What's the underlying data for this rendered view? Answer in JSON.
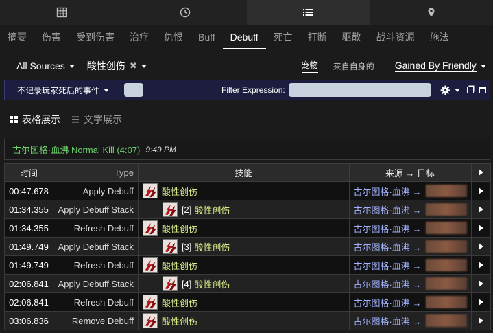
{
  "icon_bar": {
    "tabs": [
      {
        "icon": "grid-icon",
        "active": false
      },
      {
        "icon": "clock-icon",
        "active": false
      },
      {
        "icon": "list-icon",
        "active": true
      },
      {
        "icon": "map-pin-icon",
        "active": false
      }
    ]
  },
  "tabs": [
    "摘要",
    "伤害",
    "受到伤害",
    "治疗",
    "仇恨",
    "Buff",
    "Debuff",
    "死亡",
    "打断",
    "驱散",
    "战斗资源",
    "施法"
  ],
  "active_tab": "Debuff",
  "filters": {
    "source": "All Sources",
    "ability": "酸性创伤",
    "clear_mark": "✖",
    "toggle_pet": "宠物",
    "toggle_self": "来自自身的",
    "friendly": "Gained By Friendly"
  },
  "expression_bar": {
    "ignore_deaths": "不记录玩家死后的事件",
    "filter_label": "Filter Expression:",
    "filter_value": ""
  },
  "view": {
    "table_label": "表格展示",
    "text_label": "文字展示"
  },
  "fight": {
    "name": "古尔图格·血沸 Normal Kill (4:07)",
    "time": "9:49 PM"
  },
  "table": {
    "headers": {
      "time": "时间",
      "type": "Type",
      "skill": "技能",
      "source": "来源 → 目标"
    },
    "rows": [
      {
        "time": "00:47.678",
        "type": "Apply Debuff",
        "stack": "",
        "skill": "酸性创伤",
        "source": "古尔图格·血沸 →"
      },
      {
        "time": "01:34.355",
        "type": "Apply Debuff Stack",
        "stack": "[2]",
        "skill": "酸性创伤",
        "source": "古尔图格·血沸 →"
      },
      {
        "time": "01:34.355",
        "type": "Refresh Debuff",
        "stack": "",
        "skill": "酸性创伤",
        "source": "古尔图格·血沸 →"
      },
      {
        "time": "01:49.749",
        "type": "Apply Debuff Stack",
        "stack": "[3]",
        "skill": "酸性创伤",
        "source": "古尔图格·血沸 →"
      },
      {
        "time": "01:49.749",
        "type": "Refresh Debuff",
        "stack": "",
        "skill": "酸性创伤",
        "source": "古尔图格·血沸 →"
      },
      {
        "time": "02:06.841",
        "type": "Apply Debuff Stack",
        "stack": "[4]",
        "skill": "酸性创伤",
        "source": "古尔图格·血沸 →"
      },
      {
        "time": "02:06.841",
        "type": "Refresh Debuff",
        "stack": "",
        "skill": "酸性创伤",
        "source": "古尔图格·血沸 →"
      },
      {
        "time": "03:06.836",
        "type": "Remove Debuff",
        "stack": "",
        "skill": "酸性创伤",
        "source": "古尔图格·血沸 →"
      }
    ]
  },
  "colors": {
    "fight_green": "#6bd16b",
    "skill_yellow": "#d7ee8a",
    "source_blue": "#a3b2ff",
    "expression_bg": "#1c1d3f"
  }
}
